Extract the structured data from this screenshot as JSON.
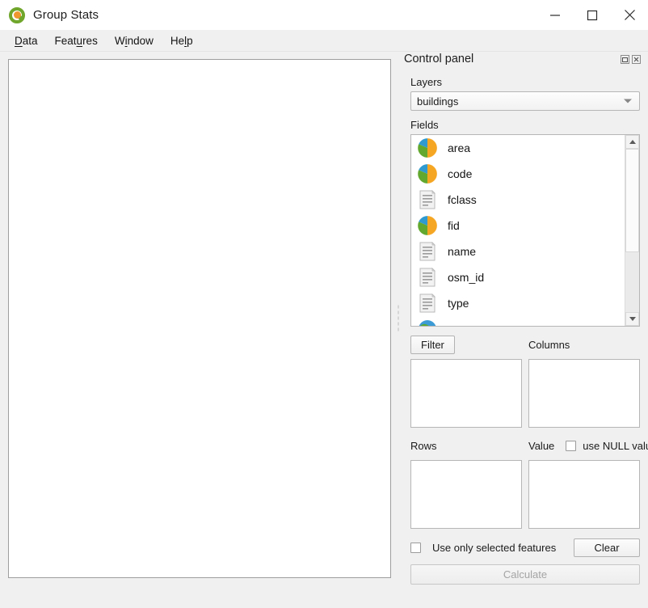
{
  "window": {
    "title": "Group Stats",
    "logo_icon": "qgis-logo-icon",
    "minimize_label": "—",
    "maximize_label": "□",
    "close_label": "✕"
  },
  "menubar": {
    "items": [
      {
        "label": "Data",
        "pre": "",
        "mnemonic": "D",
        "post": "ata"
      },
      {
        "label": "Features",
        "pre": "Feat",
        "mnemonic": "u",
        "post": "res"
      },
      {
        "label": "Window",
        "pre": "W",
        "mnemonic": "i",
        "post": "ndow"
      },
      {
        "label": "Help",
        "pre": "He",
        "mnemonic": "l",
        "post": "p"
      }
    ]
  },
  "result_area": {
    "name": "results-table",
    "content": ""
  },
  "panel": {
    "title": "Control panel",
    "float_icon": "float-panel-icon",
    "close_icon": "close-panel-icon",
    "layers": {
      "label": "Layers",
      "selected": "buildings",
      "options": [
        "buildings"
      ]
    },
    "fields": {
      "label": "Fields",
      "items": [
        {
          "name": "area",
          "type": "numeric"
        },
        {
          "name": "code",
          "type": "numeric"
        },
        {
          "name": "fclass",
          "type": "text"
        },
        {
          "name": "fid",
          "type": "numeric"
        },
        {
          "name": "name",
          "type": "text"
        },
        {
          "name": "osm_id",
          "type": "text"
        },
        {
          "name": "type",
          "type": "text"
        },
        {
          "name": "",
          "type": "geometry"
        }
      ]
    },
    "filter": {
      "label": "Filter"
    },
    "columns": {
      "label": "Columns",
      "content": ""
    },
    "rows": {
      "label": "Rows",
      "content": ""
    },
    "value": {
      "label": "Value",
      "content": ""
    },
    "use_null": {
      "label": "use NULL values",
      "checked": false
    },
    "use_selected": {
      "label": "Use only selected features",
      "checked": false
    },
    "clear": {
      "label": "Clear"
    },
    "calculate": {
      "label": "Calculate",
      "enabled": false
    }
  },
  "colors": {
    "window_bg": "#f0f0f0",
    "titlebar_bg": "#ffffff",
    "field_numeric_blue": "#2e9ad0",
    "field_numeric_green": "#63a82e",
    "field_numeric_orange": "#f5a623",
    "logo_green": "#6fa62b",
    "logo_orange": "#f0962e",
    "disabled_text": "#a4a4a4"
  }
}
